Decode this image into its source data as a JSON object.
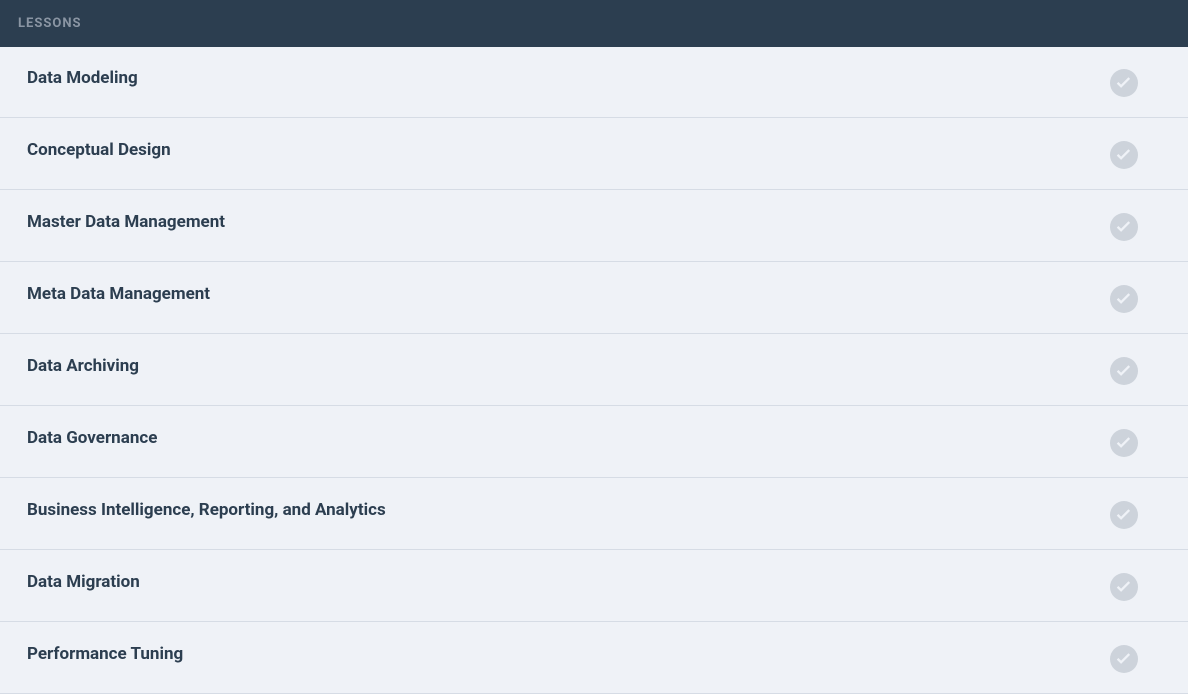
{
  "header": {
    "title": "LESSONS"
  },
  "lessons": [
    {
      "title": "Data Modeling",
      "completed": false
    },
    {
      "title": "Conceptual Design",
      "completed": false
    },
    {
      "title": "Master Data Management",
      "completed": false
    },
    {
      "title": "Meta Data Management",
      "completed": false
    },
    {
      "title": "Data Archiving",
      "completed": false
    },
    {
      "title": "Data Governance",
      "completed": false
    },
    {
      "title": "Business Intelligence, Reporting, and Analytics",
      "completed": false
    },
    {
      "title": "Data Migration",
      "completed": false
    },
    {
      "title": "Performance Tuning",
      "completed": false
    }
  ]
}
